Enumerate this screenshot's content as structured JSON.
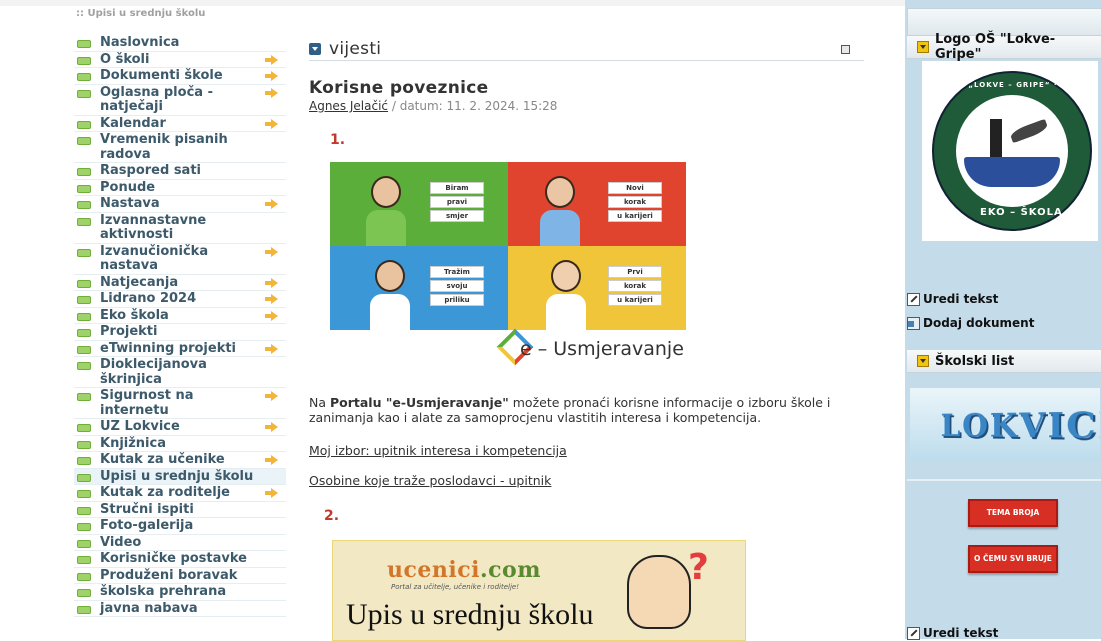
{
  "breadcrumb": ":: Upisi u srednju školu",
  "nav": [
    {
      "label": "Naslovnica",
      "arrow": false
    },
    {
      "label": "O školi",
      "arrow": true
    },
    {
      "label": "Dokumenti škole",
      "arrow": true
    },
    {
      "label": "Oglasna ploča - natječaji",
      "arrow": true
    },
    {
      "label": "Kalendar",
      "arrow": true
    },
    {
      "label": "Vremenik pisanih radova",
      "arrow": false
    },
    {
      "label": "Raspored sati",
      "arrow": false
    },
    {
      "label": "Ponude",
      "arrow": false
    },
    {
      "label": "Nastava",
      "arrow": true
    },
    {
      "label": "Izvannastavne aktivnosti",
      "arrow": false
    },
    {
      "label": "Izvanučionička nastava",
      "arrow": true
    },
    {
      "label": "Natjecanja",
      "arrow": true
    },
    {
      "label": "Lidrano 2024",
      "arrow": true
    },
    {
      "label": "Eko škola",
      "arrow": true
    },
    {
      "label": "Projekti",
      "arrow": false
    },
    {
      "label": "eTwinning projekti",
      "arrow": true
    },
    {
      "label": "Dioklecijanova škrinjica",
      "arrow": false
    },
    {
      "label": "Sigurnost na internetu",
      "arrow": true
    },
    {
      "label": "UZ Lokvice",
      "arrow": true
    },
    {
      "label": "Knjižnica",
      "arrow": false
    },
    {
      "label": "Kutak za učenike",
      "arrow": true
    },
    {
      "label": "Upisi u srednju školu",
      "arrow": false,
      "active": true
    },
    {
      "label": "Kutak za roditelje",
      "arrow": true
    },
    {
      "label": "Stručni ispiti",
      "arrow": false
    },
    {
      "label": "Foto-galerija",
      "arrow": false
    },
    {
      "label": "Video",
      "arrow": false
    },
    {
      "label": "Korisničke postavke",
      "arrow": false
    },
    {
      "label": "Produženi boravak",
      "arrow": false
    },
    {
      "label": "školska prehrana",
      "arrow": false
    },
    {
      "label": "javna nabava",
      "arrow": false
    }
  ],
  "main": {
    "section_title": "vijesti",
    "post_title": "Korisne poveznice",
    "author": "Agnes Jelačić",
    "meta_rest": " / datum: 11. 2. 2024. 15:28",
    "num1": "1.",
    "num2": "2.",
    "promo": {
      "tags": [
        [
          "Biram",
          "pravi",
          "smjer"
        ],
        [
          "Novi",
          "korak",
          "u karijeri"
        ],
        [
          "Tražim",
          "svoju",
          "priliku"
        ],
        [
          "Prvi",
          "korak",
          "u karijeri"
        ]
      ],
      "brand": "e – Usmjeravanje"
    },
    "body_pre": "Na ",
    "body_bold": "Portalu \"e-Usmjeravanje\"",
    "body_post": " možete pronaći korisne informacije o izboru škole i zanimanja kao i alate za samoprocjenu vlastitih interesa i kompetencija.",
    "link1": "Moj izbor: upitnik interesa i kompetencija",
    "link2": "Osobine koje traže poslodavci  - upitnik",
    "banner2": {
      "logo_a": "ucenici",
      "logo_b": ".com",
      "sub": "Portal za učitelje, učenike i roditelje!",
      "headline": "Upis u srednju školu",
      "q": "?"
    }
  },
  "right": {
    "logo_header": "Logo OŠ \"Lokve-Gripe\"",
    "seal_top": "OŠ „LOKVE – GRIPE“ · SPLIT",
    "seal_bottom": "EKO – ŠKOLA",
    "edit_text": "Uredi tekst",
    "add_doc": "Dodaj dokument",
    "school_paper_header": "Školski list",
    "lokvice": "LOKVICE",
    "btn1": "TEMA BROJA",
    "btn2": "O ČEMU SVI BRUJE",
    "edit_text_2": "Uredi tekst"
  }
}
